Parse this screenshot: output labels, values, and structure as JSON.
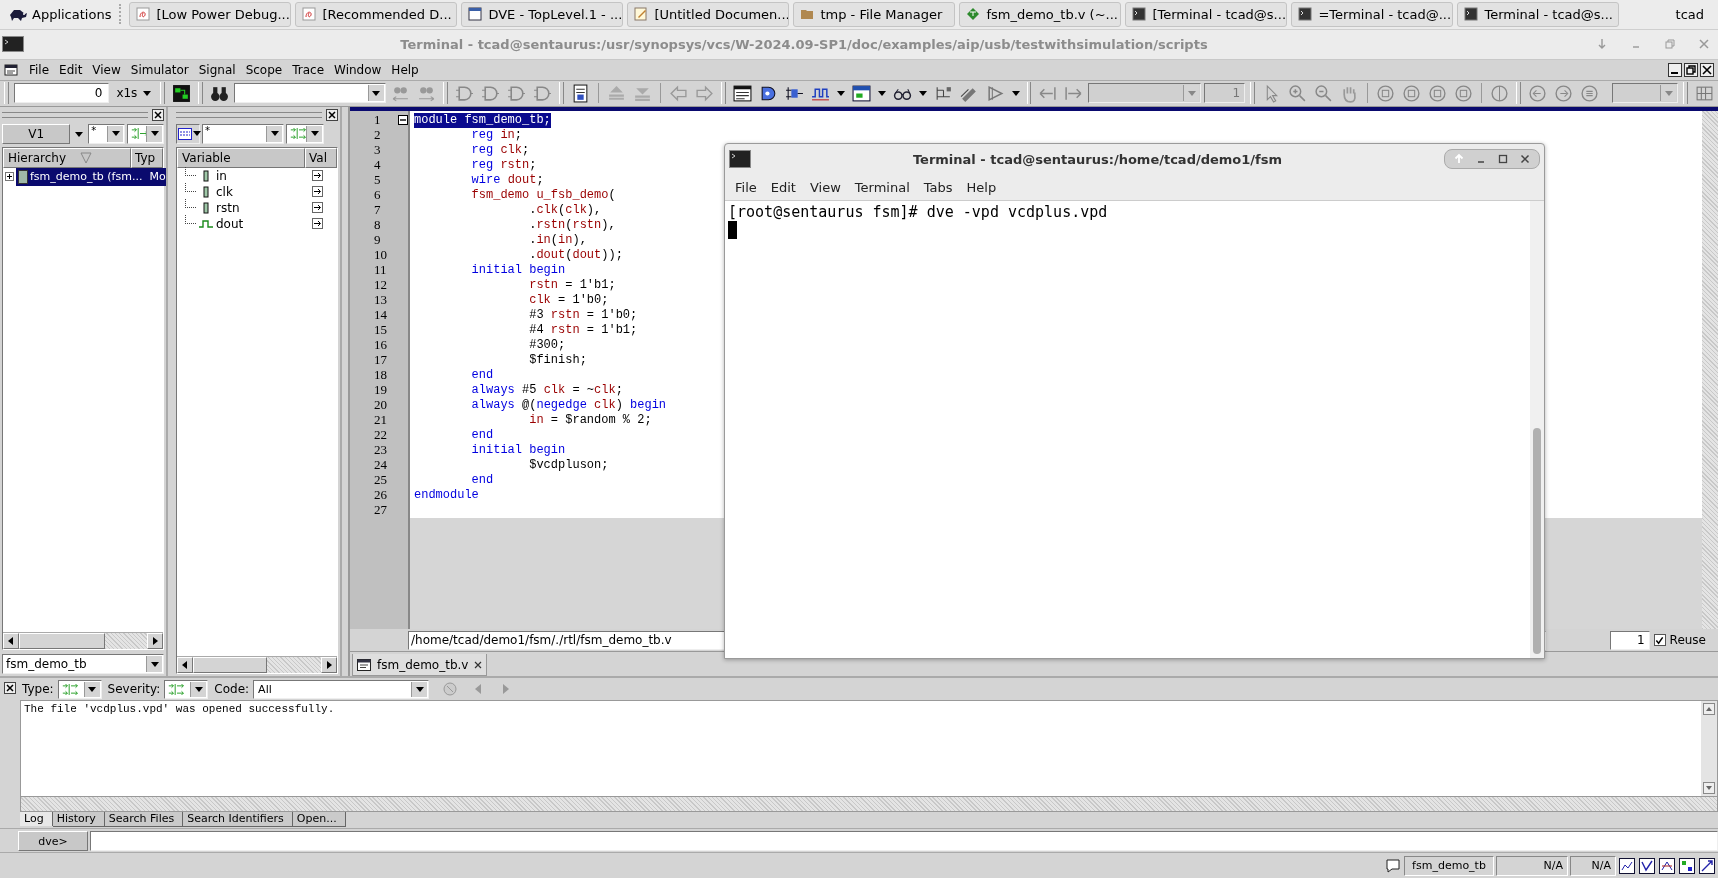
{
  "taskbar": {
    "launcher": "Applications",
    "user": "tcad",
    "tasks": [
      {
        "label": "[Low Power Debug...",
        "kind": "pdf"
      },
      {
        "label": "[Recommended D...",
        "kind": "pdf"
      },
      {
        "label": "DVE - TopLevel.1 - ...",
        "kind": "window"
      },
      {
        "label": "[Untitled Documen...",
        "kind": "editor"
      },
      {
        "label": "tmp - File Manager",
        "kind": "folder"
      },
      {
        "label": "fsm_demo_tb.v (~...",
        "kind": "vim"
      },
      {
        "label": "[Terminal - tcad@s...",
        "kind": "terminal"
      },
      {
        "label": "=Terminal - tcad@...",
        "kind": "terminal"
      },
      {
        "label": "Terminal - tcad@s...",
        "kind": "terminal"
      }
    ]
  },
  "window": {
    "title": "Terminal - tcad@sentaurus:/usr/synopsys/vcs/W-2024.09-SP1/doc/examples/aip/usb/testwithsimulation/scripts"
  },
  "menu": [
    "File",
    "Edit",
    "View",
    "Simulator",
    "Signal",
    "Scope",
    "Trace",
    "Window",
    "Help"
  ],
  "toolbar": {
    "time": "0",
    "time_unit": "x1s",
    "page": "1"
  },
  "hierarchy_panel": {
    "view": "V1",
    "filter": "*",
    "columns": [
      "Hierarchy",
      "Typ"
    ],
    "scope": "fsm_demo_tb",
    "rows": [
      {
        "name": "fsm_demo_tb (fsm...",
        "type": "Mo",
        "selected": true,
        "expanded": false
      }
    ]
  },
  "variable_panel": {
    "filter": "*",
    "columns": [
      "Variable",
      "Val"
    ],
    "rows": [
      {
        "name": "in",
        "kind": "reg"
      },
      {
        "name": "clk",
        "kind": "reg"
      },
      {
        "name": "rstn",
        "kind": "reg"
      },
      {
        "name": "dout",
        "kind": "wire"
      }
    ]
  },
  "source": {
    "path": "/home/tcad/demo1/fsm/./rtl/fsm_demo_tb.v",
    "line_field": "1",
    "reuse": {
      "label": "Reuse",
      "checked": true
    },
    "tabs": [
      {
        "label": "fsm_demo_tb.v",
        "selected": true
      }
    ],
    "lines": [
      {
        "number": "1",
        "selected": true,
        "fold": true,
        "tokens": [
          {
            "text": "module fsm_demo_tb;"
          }
        ]
      },
      {
        "number": "2",
        "selected": false,
        "fold": false,
        "tokens": [
          {
            "kind": "keyword",
            "text": "        reg "
          },
          {
            "kind": "name",
            "text": "in"
          },
          {
            "kind": "plain",
            "text": ";"
          }
        ]
      },
      {
        "number": "3",
        "selected": false,
        "fold": false,
        "tokens": [
          {
            "kind": "keyword",
            "text": "        reg "
          },
          {
            "kind": "name",
            "text": "clk"
          },
          {
            "kind": "plain",
            "text": ";"
          }
        ]
      },
      {
        "number": "4",
        "selected": false,
        "fold": false,
        "tokens": [
          {
            "kind": "keyword",
            "text": "        reg "
          },
          {
            "kind": "name",
            "text": "rstn"
          },
          {
            "kind": "plain",
            "text": ";"
          }
        ]
      },
      {
        "number": "5",
        "selected": false,
        "fold": false,
        "tokens": [
          {
            "kind": "keyword",
            "text": "        wire "
          },
          {
            "kind": "name",
            "text": "dout"
          },
          {
            "kind": "plain",
            "text": ";"
          }
        ]
      },
      {
        "number": "6",
        "selected": false,
        "fold": false,
        "tokens": [
          {
            "kind": "name",
            "text": "        fsm_demo u_fsb_demo"
          },
          {
            "kind": "plain",
            "text": "("
          }
        ]
      },
      {
        "number": "7",
        "selected": false,
        "fold": false,
        "tokens": [
          {
            "kind": "plain",
            "text": "                ."
          },
          {
            "kind": "name",
            "text": "clk"
          },
          {
            "kind": "plain",
            "text": "("
          },
          {
            "kind": "name",
            "text": "clk"
          },
          {
            "kind": "plain",
            "text": "),"
          }
        ]
      },
      {
        "number": "8",
        "selected": false,
        "fold": false,
        "tokens": [
          {
            "kind": "plain",
            "text": "                ."
          },
          {
            "kind": "name",
            "text": "rstn"
          },
          {
            "kind": "plain",
            "text": "("
          },
          {
            "kind": "name",
            "text": "rstn"
          },
          {
            "kind": "plain",
            "text": "),"
          }
        ]
      },
      {
        "number": "9",
        "selected": false,
        "fold": false,
        "tokens": [
          {
            "kind": "plain",
            "text": "                ."
          },
          {
            "kind": "name",
            "text": "in"
          },
          {
            "kind": "plain",
            "text": "("
          },
          {
            "kind": "name",
            "text": "in"
          },
          {
            "kind": "plain",
            "text": "),"
          }
        ]
      },
      {
        "number": "10",
        "selected": false,
        "fold": false,
        "tokens": [
          {
            "kind": "plain",
            "text": "                ."
          },
          {
            "kind": "name",
            "text": "dout"
          },
          {
            "kind": "plain",
            "text": "("
          },
          {
            "kind": "name",
            "text": "dout"
          },
          {
            "kind": "plain",
            "text": "));"
          }
        ]
      },
      {
        "number": "11",
        "selected": false,
        "fold": false,
        "tokens": [
          {
            "kind": "keyword",
            "text": "        initial begin"
          }
        ]
      },
      {
        "number": "12",
        "selected": false,
        "fold": false,
        "tokens": [
          {
            "kind": "name",
            "text": "                rstn"
          },
          {
            "kind": "plain",
            "text": " = 1'b1;"
          }
        ]
      },
      {
        "number": "13",
        "selected": false,
        "fold": false,
        "tokens": [
          {
            "kind": "name",
            "text": "                clk"
          },
          {
            "kind": "plain",
            "text": " = 1'b0;"
          }
        ]
      },
      {
        "number": "14",
        "selected": false,
        "fold": false,
        "tokens": [
          {
            "kind": "plain",
            "text": "                #3 "
          },
          {
            "kind": "name",
            "text": "rstn"
          },
          {
            "kind": "plain",
            "text": " = 1'b0;"
          }
        ]
      },
      {
        "number": "15",
        "selected": false,
        "fold": false,
        "tokens": [
          {
            "kind": "plain",
            "text": "                #4 "
          },
          {
            "kind": "name",
            "text": "rstn"
          },
          {
            "kind": "plain",
            "text": " = 1'b1;"
          }
        ]
      },
      {
        "number": "16",
        "selected": false,
        "fold": false,
        "tokens": [
          {
            "kind": "plain",
            "text": "                #300;"
          }
        ]
      },
      {
        "number": "17",
        "selected": false,
        "fold": false,
        "tokens": [
          {
            "kind": "plain",
            "text": "                $finish;"
          }
        ]
      },
      {
        "number": "18",
        "selected": false,
        "fold": false,
        "tokens": [
          {
            "kind": "keyword",
            "text": "        end"
          }
        ]
      },
      {
        "number": "19",
        "selected": false,
        "fold": false,
        "tokens": [
          {
            "kind": "keyword",
            "text": "        always"
          },
          {
            "kind": "plain",
            "text": " #5 "
          },
          {
            "kind": "name",
            "text": "clk"
          },
          {
            "kind": "plain",
            "text": " = ~"
          },
          {
            "kind": "name",
            "text": "clk"
          },
          {
            "kind": "plain",
            "text": ";"
          }
        ]
      },
      {
        "number": "20",
        "selected": false,
        "fold": false,
        "tokens": [
          {
            "kind": "keyword",
            "text": "        always"
          },
          {
            "kind": "plain",
            "text": " @("
          },
          {
            "kind": "keyword",
            "text": "negedge "
          },
          {
            "kind": "name",
            "text": "clk"
          },
          {
            "kind": "plain",
            "text": ") "
          },
          {
            "kind": "keyword",
            "text": "begin"
          }
        ]
      },
      {
        "number": "21",
        "selected": false,
        "fold": false,
        "tokens": [
          {
            "kind": "name",
            "text": "                in"
          },
          {
            "kind": "plain",
            "text": " = $random % 2;"
          }
        ]
      },
      {
        "number": "22",
        "selected": false,
        "fold": false,
        "tokens": [
          {
            "kind": "keyword",
            "text": "        end"
          }
        ]
      },
      {
        "number": "23",
        "selected": false,
        "fold": false,
        "tokens": [
          {
            "kind": "keyword",
            "text": "        initial begin"
          }
        ]
      },
      {
        "number": "24",
        "selected": false,
        "fold": false,
        "tokens": [
          {
            "kind": "plain",
            "text": "                $vcdpluson;"
          }
        ]
      },
      {
        "number": "25",
        "selected": false,
        "fold": false,
        "tokens": [
          {
            "kind": "keyword",
            "text": "        end"
          }
        ]
      },
      {
        "number": "26",
        "selected": false,
        "fold": false,
        "tokens": [
          {
            "kind": "keyword",
            "text": "endmodule"
          }
        ]
      },
      {
        "number": "27",
        "selected": false,
        "fold": false
      }
    ]
  },
  "console": {
    "filters": [
      "Type:",
      "Severity:"
    ],
    "code_label": "Code:",
    "code_value": "All",
    "messages": [
      "The file 'vcdplus.vpd' was opened successfully."
    ],
    "tabs": [
      {
        "label": "Log",
        "selected": true
      },
      {
        "label": "History",
        "selected": false
      },
      {
        "label": "Search Files",
        "selected": false
      },
      {
        "label": "Search Identifiers",
        "selected": false
      },
      {
        "label": "Open...",
        "selected": false
      }
    ],
    "prompt": "dve>"
  },
  "status_bar": {
    "scope": "fsm_demo_tb",
    "fields": [
      "N/A",
      "N/A"
    ]
  },
  "terminal": {
    "title": "Terminal - tcad@sentaurus:/home/tcad/demo1/fsm",
    "menu": [
      "File",
      "Edit",
      "View",
      "Terminal",
      "Tabs",
      "Help"
    ],
    "lines": [
      "[root@sentaurus fsm]# dve -vpd vcdplus.vpd"
    ],
    "cursor": true
  }
}
